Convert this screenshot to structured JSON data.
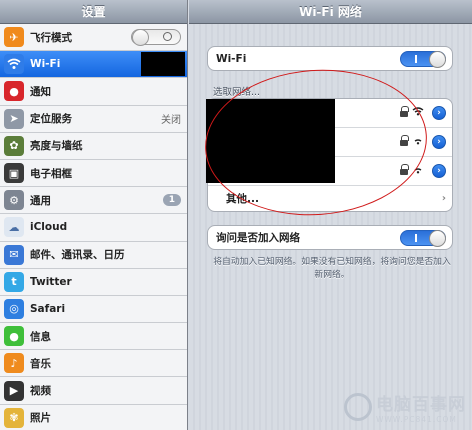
{
  "sidebar": {
    "title": "设置",
    "items": [
      {
        "label": "飞行模式",
        "icon": "airplane-icon",
        "color": "#f08a1c"
      },
      {
        "label": "Wi-Fi",
        "icon": "wifi-icon",
        "color": "#2f7ce8",
        "selected": true
      },
      {
        "label": "通知",
        "icon": "notifications-icon",
        "color": "#d8262b"
      },
      {
        "label": "定位服务",
        "icon": "location-icon",
        "color": "#8f98a6",
        "value": "关闭"
      },
      {
        "label": "亮度与墙纸",
        "icon": "brightness-icon",
        "color": "#5b7d3a"
      },
      {
        "label": "电子相框",
        "icon": "picture-frame-icon",
        "color": "#3a3a3a"
      },
      {
        "label": "通用",
        "icon": "gear-icon",
        "color": "#7d8592",
        "badge": "1"
      },
      {
        "label": "iCloud",
        "icon": "cloud-icon",
        "color": "#dfe7f1"
      },
      {
        "label": "邮件、通讯录、日历",
        "icon": "mail-icon",
        "color": "#3a78d6"
      },
      {
        "label": "Twitter",
        "icon": "twitter-icon",
        "color": "#33a8e6"
      },
      {
        "label": "Safari",
        "icon": "safari-icon",
        "color": "#2e7fe0"
      },
      {
        "label": "信息",
        "icon": "messages-icon",
        "color": "#3fbf3a"
      },
      {
        "label": "音乐",
        "icon": "music-icon",
        "color": "#ef8b1e"
      },
      {
        "label": "视频",
        "icon": "video-icon",
        "color": "#333333"
      },
      {
        "label": "照片",
        "icon": "photos-icon",
        "color": "#e4b43a"
      }
    ]
  },
  "main": {
    "title": "Wi-Fi 网络",
    "wifi_label": "Wi-Fi",
    "wifi_on": true,
    "choose_network_label": "选取网络...",
    "networks": [
      {
        "locked": true
      },
      {
        "locked": true
      },
      {
        "locked": true
      }
    ],
    "other_label": "其他...",
    "ask_to_join_label": "询问是否加入网络",
    "ask_to_join_on": true,
    "caption": "将自动加入已知网络。如果没有已知网络，将询问您是否加入新网络。",
    "toggle_on_mark": "I"
  },
  "watermark": {
    "cn": "电脑百事网",
    "en": "WWW.PC841.COM"
  },
  "colors": {
    "accent": "#2f7ce8",
    "annotation": "#d01a1a"
  }
}
